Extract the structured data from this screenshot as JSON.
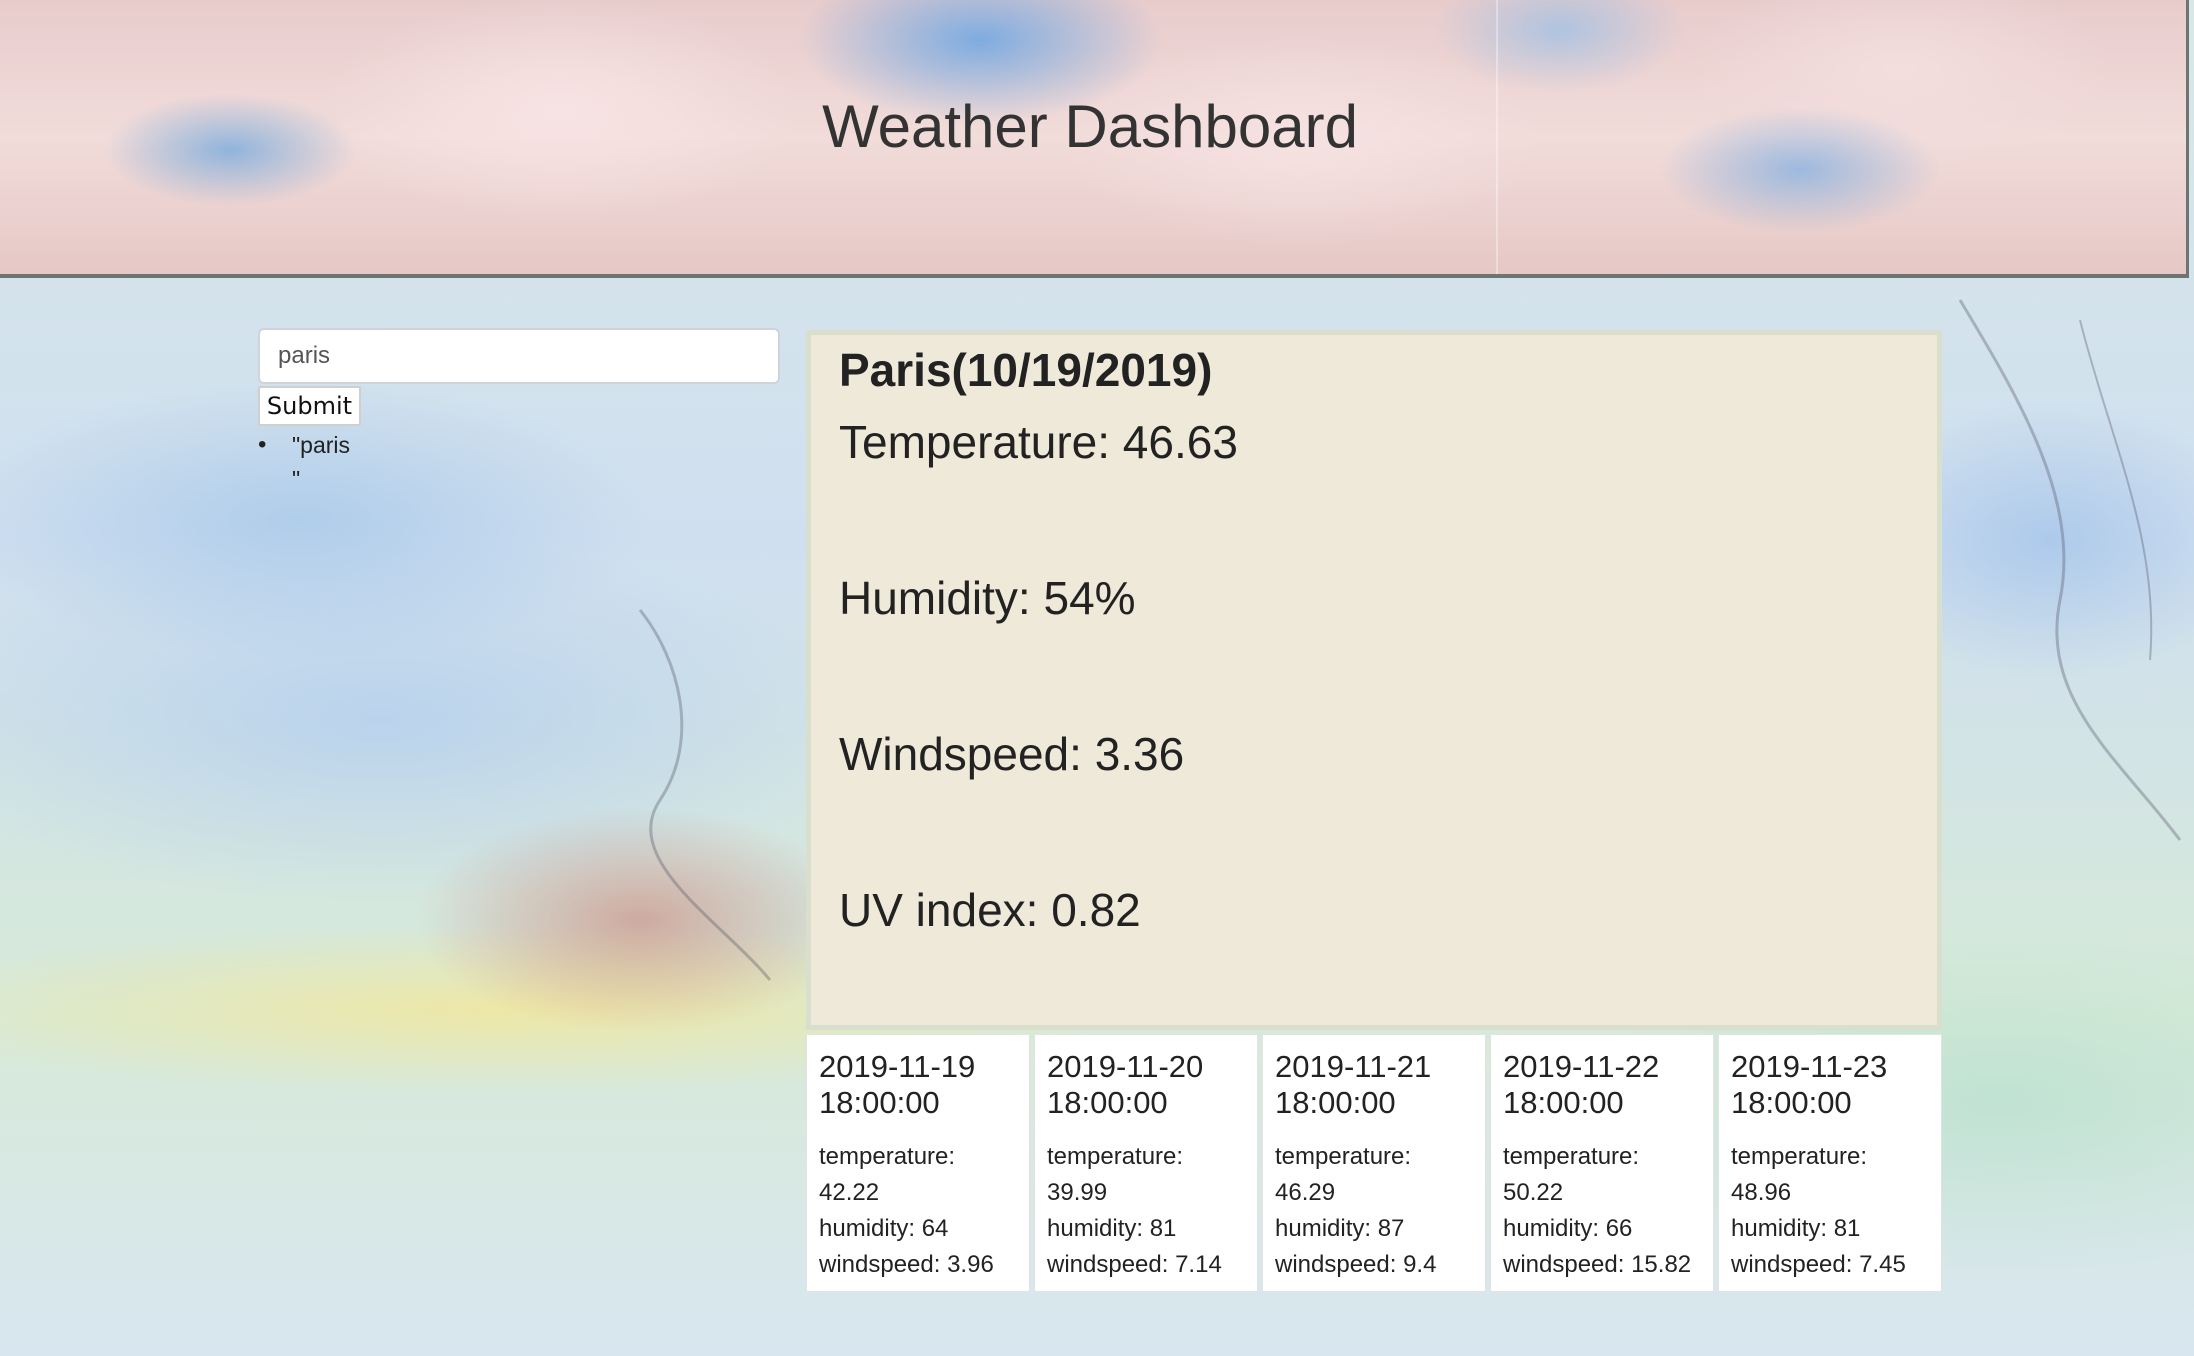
{
  "header": {
    "title": "Weather Dashboard"
  },
  "search": {
    "value": "paris",
    "submit_label": "Submit"
  },
  "history": [
    "\"paris\n\""
  ],
  "current": {
    "city_date": "Paris(10/19/2019)",
    "temperature": "Temperature: 46.63",
    "humidity": "Humidity: 54%",
    "windspeed": "Windspeed: 3.36",
    "uv_index": "UV index: 0.82"
  },
  "forecast": [
    {
      "date": "2019-11-19",
      "time": "18:00:00",
      "temp_label": "temperature:",
      "temp": "42.22",
      "humidity": "humidity: 64",
      "wind": "windspeed: 3.96"
    },
    {
      "date": "2019-11-20",
      "time": "18:00:00",
      "temp_label": "temperature:",
      "temp": "39.99",
      "humidity": "humidity: 81",
      "wind": "windspeed: 7.14"
    },
    {
      "date": "2019-11-21",
      "time": "18:00:00",
      "temp_label": "temperature:",
      "temp": "46.29",
      "humidity": "humidity: 87",
      "wind": "windspeed: 9.4"
    },
    {
      "date": "2019-11-22",
      "time": "18:00:00",
      "temp_label": "temperature:",
      "temp": "50.22",
      "humidity": "humidity: 66",
      "wind": "windspeed: 15.82"
    },
    {
      "date": "2019-11-23",
      "time": "18:00:00",
      "temp_label": "temperature:",
      "temp": "48.96",
      "humidity": "humidity: 81",
      "wind": "windspeed: 7.45"
    }
  ]
}
